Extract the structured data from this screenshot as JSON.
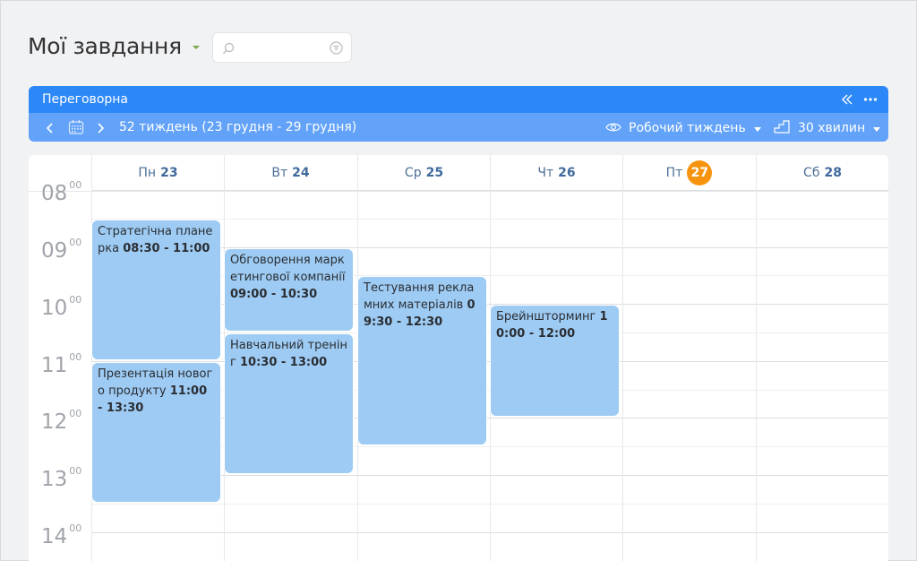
{
  "page": {
    "title": "Мої завдання"
  },
  "search": {
    "value": "",
    "placeholder": ""
  },
  "calendar": {
    "room": "Переговорна",
    "week_label": "52 тиждень (23 грудня - 29 грудня)",
    "view_mode": "Робочий тиждень",
    "time_step": "30 хвилин",
    "days": [
      {
        "name": "Пн",
        "num": "23",
        "today": false
      },
      {
        "name": "Вт",
        "num": "24",
        "today": false
      },
      {
        "name": "Ср",
        "num": "25",
        "today": false
      },
      {
        "name": "Чт",
        "num": "26",
        "today": false
      },
      {
        "name": "Пт",
        "num": "27",
        "today": true
      },
      {
        "name": "Сб",
        "num": "28",
        "today": false
      }
    ],
    "hours": [
      {
        "h": "08",
        "m": "00"
      },
      {
        "h": "09",
        "m": "00"
      },
      {
        "h": "10",
        "m": "00"
      },
      {
        "h": "11",
        "m": "00"
      },
      {
        "h": "12",
        "m": "00"
      },
      {
        "h": "13",
        "m": "00"
      },
      {
        "h": "14",
        "m": "00"
      }
    ],
    "events": [
      {
        "title": "Стратегічна планерка",
        "time": "08:30 - 11:00"
      },
      {
        "title": "Презентація нового продукту",
        "time": "11:00 - 13:30"
      },
      {
        "title": "Обговорення маркетингової компанії",
        "time": "09:00 - 10:30"
      },
      {
        "title": "Навчальний тренінг",
        "time": "10:30 - 13:00"
      },
      {
        "title": "Тестування рекламних матеріалів",
        "time": "09:30 - 12:30"
      },
      {
        "title": "Брейншторминг",
        "time": "10:00 - 12:00"
      }
    ]
  },
  "colors": {
    "header_top": "#2d88f7",
    "header_bottom": "#62a2f8",
    "event_fill": "#9ecbf3",
    "today_badge": "#f7940f",
    "title_caret": "#7aa74b"
  },
  "icons": {
    "search": "search-icon",
    "filter": "filter-icon",
    "collapse": "double-chevron-left-icon",
    "more": "more-dots-icon",
    "prev": "chevron-left-icon",
    "calendar": "calendar-icon",
    "next": "chevron-right-icon",
    "view": "eye-icon",
    "step": "steps-icon"
  }
}
